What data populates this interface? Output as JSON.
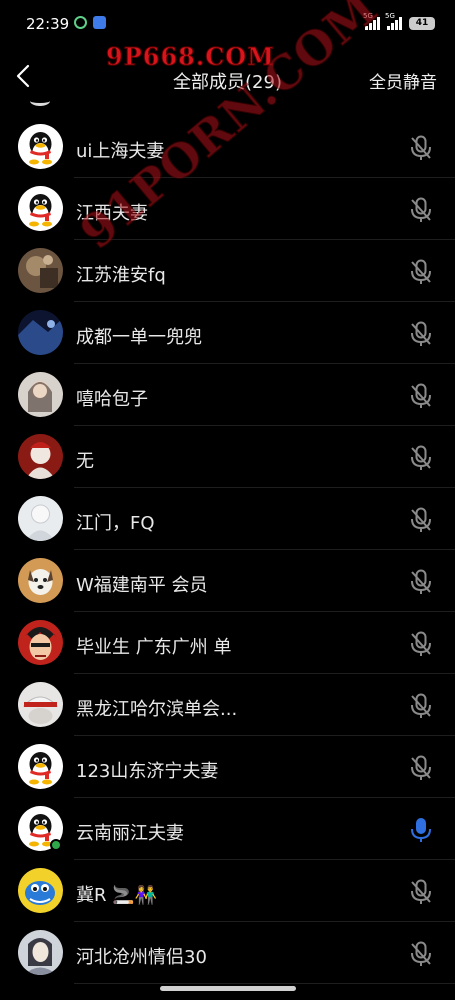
{
  "status_bar": {
    "time": "22:39",
    "signal_1_tag": "5G",
    "signal_2_tag": "5G",
    "battery": "41"
  },
  "watermark": {
    "top": "9P668.COM",
    "diagonal": "91PORN.COM"
  },
  "header": {
    "back_icon": "chevron-left-icon",
    "title": "全部成员(29)",
    "mute_all_label": "全员静音"
  },
  "members": [
    {
      "name": "ui上海夫妻",
      "avatar": "qq-penguin",
      "mic": "muted"
    },
    {
      "name": "江西夫妻",
      "avatar": "qq-penguin",
      "mic": "muted"
    },
    {
      "name": "江苏淮安fq",
      "avatar": "photo-brown",
      "mic": "muted"
    },
    {
      "name": "成都一单一兜兜",
      "avatar": "photo-blue",
      "mic": "muted"
    },
    {
      "name": "嘻哈包子",
      "avatar": "photo-girl",
      "mic": "muted"
    },
    {
      "name": "无",
      "avatar": "photo-red",
      "mic": "muted"
    },
    {
      "name": "江门，FQ",
      "avatar": "photo-white",
      "mic": "muted"
    },
    {
      "name": "W福建南平 会员",
      "avatar": "photo-dog",
      "mic": "muted"
    },
    {
      "name": "毕业生  广东广州 单",
      "avatar": "photo-anime",
      "mic": "muted"
    },
    {
      "name": "黑龙江哈尔滨单会...",
      "avatar": "photo-cap",
      "mic": "muted"
    },
    {
      "name": "123山东济宁夫妻",
      "avatar": "qq-penguin",
      "mic": "muted"
    },
    {
      "name": "云南丽江夫妻",
      "avatar": "qq-penguin",
      "mic": "active",
      "online": true
    },
    {
      "name": "冀R 🚬👫",
      "avatar": "cartoon-blue",
      "mic": "muted"
    },
    {
      "name": "河北沧州情侣30",
      "avatar": "photo-sketch",
      "mic": "muted"
    }
  ],
  "colors": {
    "background": "#000000",
    "mic_muted": "#8a8a8a",
    "mic_active": "#2f6fe0",
    "online": "#2ea84a"
  }
}
